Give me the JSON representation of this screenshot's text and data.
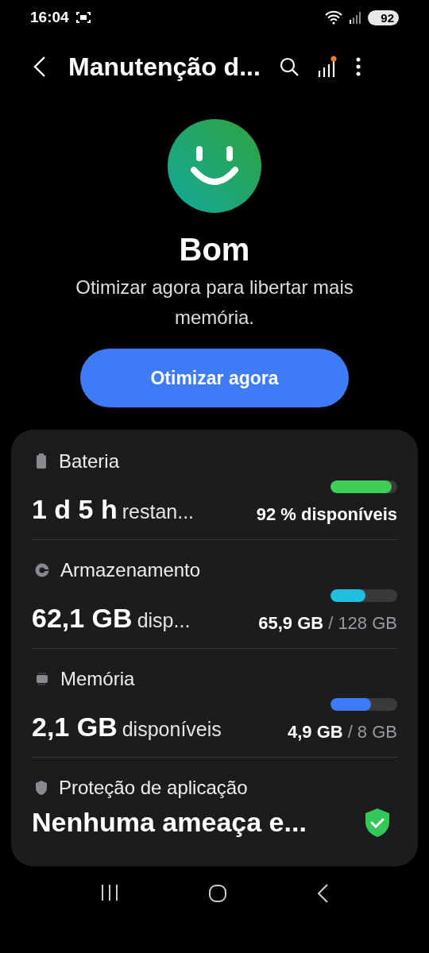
{
  "status_bar": {
    "time": "16:04",
    "battery": "92"
  },
  "app_bar": {
    "title": "Manutenção d..."
  },
  "status": {
    "title": "Bom",
    "message": "Otimizar agora para libertar mais memória.",
    "button": "Otimizar agora"
  },
  "items": [
    {
      "kind": "battery",
      "label": "Bateria",
      "value": "1 d 5 h",
      "suffix": "restan...",
      "level": 0.92,
      "color": "#3ecf58",
      "used": "92 % disponíveis"
    },
    {
      "kind": "storage",
      "label": "Armazenamento",
      "value": "62,1 GB",
      "suffix": "disp...",
      "level": 0.52,
      "color": "#1fbfe0",
      "used": "65,9 GB",
      "total": "/ 128 GB"
    },
    {
      "kind": "memory",
      "label": "Memória",
      "value": "2,1 GB",
      "suffix": "disponíveis",
      "level": 0.61,
      "color": "#3e7bf7",
      "used": "4,9 GB",
      "total": "/ 8 GB"
    },
    {
      "kind": "protection",
      "label": "Proteção de aplicação",
      "value": "Nenhuma ameaça e..."
    }
  ]
}
